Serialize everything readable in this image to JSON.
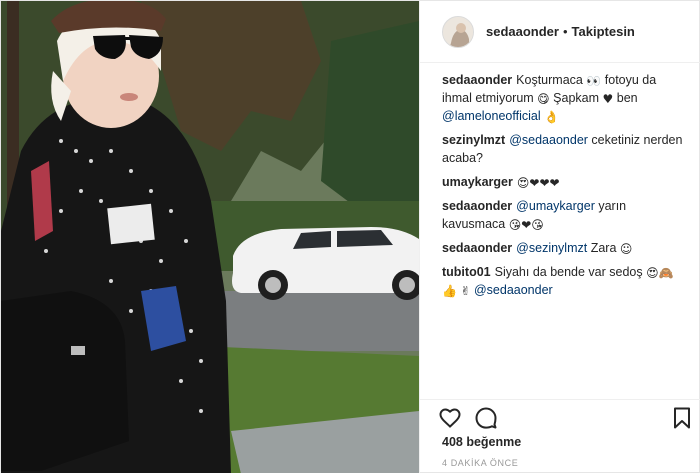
{
  "post": {
    "username": "sedaaonder",
    "separator": "•",
    "follow_status": "Takiptesin",
    "comments": [
      {
        "user": "sedaaonder",
        "parts": [
          {
            "type": "text",
            "value": "Koşturmaca "
          },
          {
            "type": "emoji",
            "value": "👀"
          },
          {
            "type": "text",
            "value": " fotoyu da ihmal etmiyorum "
          },
          {
            "type": "emoji",
            "value": "😋"
          },
          {
            "type": "text",
            "value": " Şapkam "
          },
          {
            "type": "emoji",
            "value": "♥"
          },
          {
            "type": "text",
            "value": " ben "
          },
          {
            "type": "mention",
            "value": "@lameloneofficial"
          },
          {
            "type": "text",
            "value": " "
          },
          {
            "type": "emoji",
            "value": "👌"
          }
        ]
      },
      {
        "user": "sezinylmzt",
        "parts": [
          {
            "type": "mention",
            "value": "@sedaaonder"
          },
          {
            "type": "text",
            "value": " ceketiniz nerden acaba?"
          }
        ]
      },
      {
        "user": "umaykarger",
        "parts": [
          {
            "type": "emoji",
            "value": "😍"
          },
          {
            "type": "emoji",
            "value": "❤"
          },
          {
            "type": "emoji",
            "value": "❤"
          },
          {
            "type": "emoji",
            "value": "❤"
          }
        ]
      },
      {
        "user": "sedaaonder",
        "parts": [
          {
            "type": "mention",
            "value": "@umaykarger"
          },
          {
            "type": "text",
            "value": " yarın kavusmaca "
          },
          {
            "type": "emoji",
            "value": "😘"
          },
          {
            "type": "emoji",
            "value": "❤"
          },
          {
            "type": "emoji",
            "value": "😘"
          }
        ]
      },
      {
        "user": "sedaaonder",
        "parts": [
          {
            "type": "mention",
            "value": "@sezinylmzt"
          },
          {
            "type": "text",
            "value": " Zara "
          },
          {
            "type": "emoji",
            "value": "☺"
          }
        ]
      },
      {
        "user": "tubito01",
        "parts": [
          {
            "type": "text",
            "value": "Siyahı da bende var sedoş "
          },
          {
            "type": "emoji",
            "value": "😍"
          },
          {
            "type": "emoji",
            "value": "🙈"
          },
          {
            "type": "emoji",
            "value": "👍"
          },
          {
            "type": "text",
            "value": " "
          },
          {
            "type": "emoji",
            "value": "✌"
          },
          {
            "type": "text",
            "value": " "
          },
          {
            "type": "mention",
            "value": "@sedaaonder"
          }
        ]
      }
    ],
    "likes": "408 beğenme",
    "time": "4 DAKİKA ÖNCE",
    "icons": {
      "like": "heart-outline-icon",
      "comment": "comment-bubble-icon",
      "save": "bookmark-icon"
    },
    "colors": {
      "text": "#262626",
      "mention": "#003569",
      "muted": "#999999",
      "border": "#efefef"
    }
  }
}
